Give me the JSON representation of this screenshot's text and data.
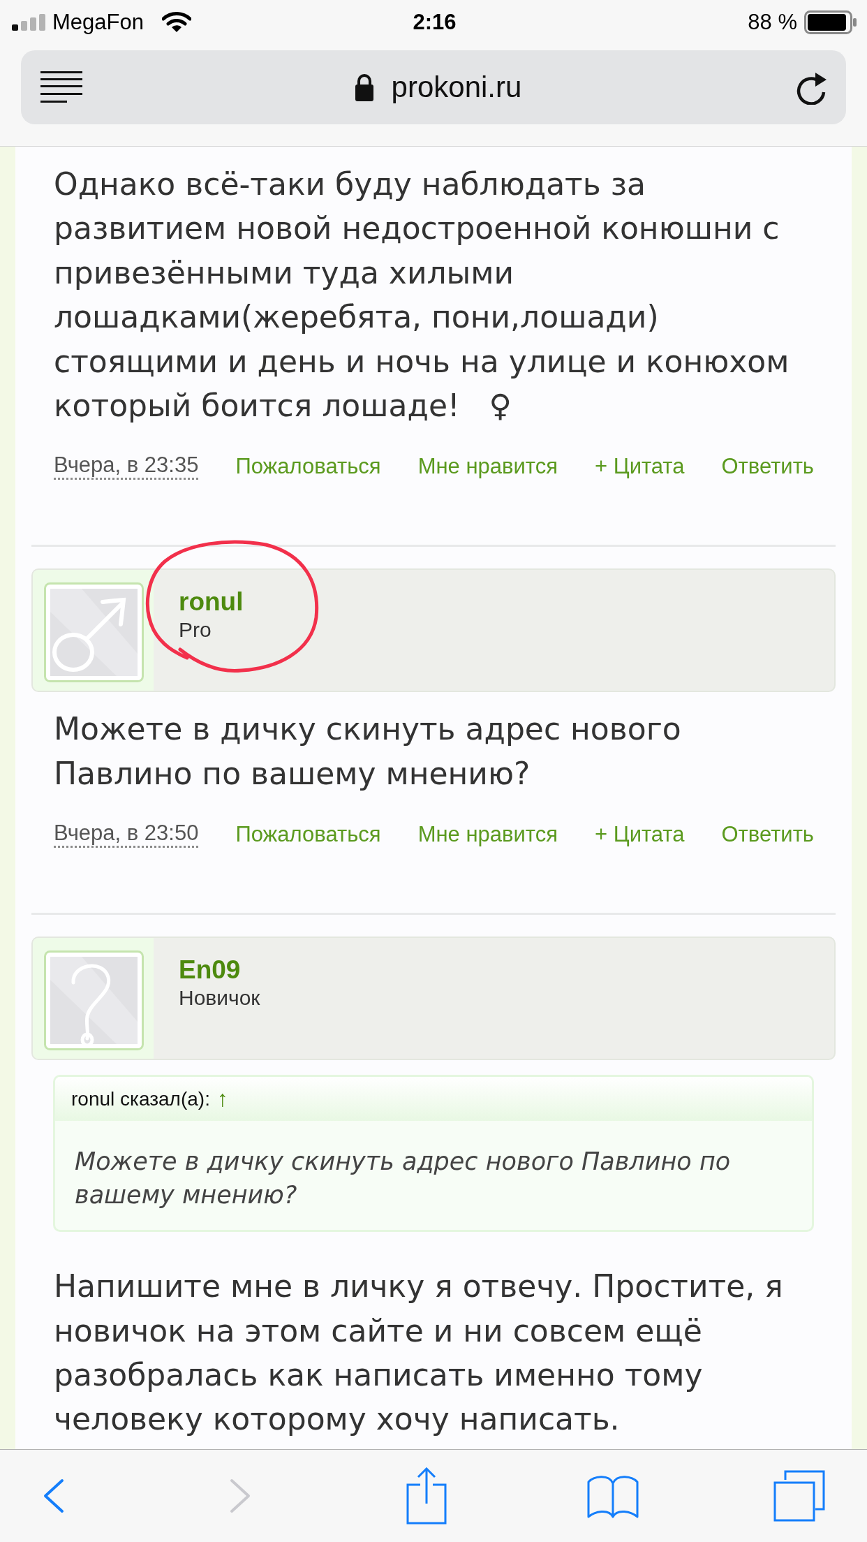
{
  "status_bar": {
    "carrier": "MegaFon",
    "time": "2:16",
    "battery": "88 %"
  },
  "address_bar": {
    "url": "prokoni.ru"
  },
  "posts": [
    {
      "body": "Однако всё-таки буду наблюдать за развитием новой недостроенной конюшни с привезёнными туда хилыми лошадками(жеребята, пони,лошади) стоящими и день и ночь на улице и конюхом который боится лошаде!   ♀",
      "time": "Вчера, в 23:35",
      "actions": [
        "Пожаловаться",
        "Мне нравится",
        "+ Цитата",
        "Ответить"
      ]
    },
    {
      "author": {
        "name": "ronul",
        "rank": "Pro",
        "avatar": {
          "kind": "male"
        },
        "circled": true
      },
      "body": "Можете в дичку скинуть адрес нового Павлино по вашему мнению?",
      "time": "Вчера, в 23:50",
      "actions": [
        "Пожаловаться",
        "Мне нравится",
        "+ Цитата",
        "Ответить"
      ]
    },
    {
      "author": {
        "name": "En09",
        "rank": "Новичок",
        "avatar": {
          "kind": "unknown"
        },
        "circled": false
      },
      "quote": {
        "author_line": "ronul сказал(а):",
        "link": "↑",
        "text": "Можете в дичку скинуть адрес нового Павлино по вашему мнению?"
      },
      "body": "Напишите мне в личку я отвечу. Простите, я новичок на этом сайте и ни совсем ещё разобралась как написать именно тому человеку которому хочу написать."
    }
  ],
  "toolbar": {
    "buttons": [
      {
        "kind": "back",
        "disabled": false
      },
      {
        "kind": "forward",
        "disabled": true
      },
      {
        "kind": "share",
        "disabled": false
      },
      {
        "kind": "bookmarks",
        "disabled": false
      },
      {
        "kind": "tabs",
        "disabled": false
      }
    ]
  }
}
